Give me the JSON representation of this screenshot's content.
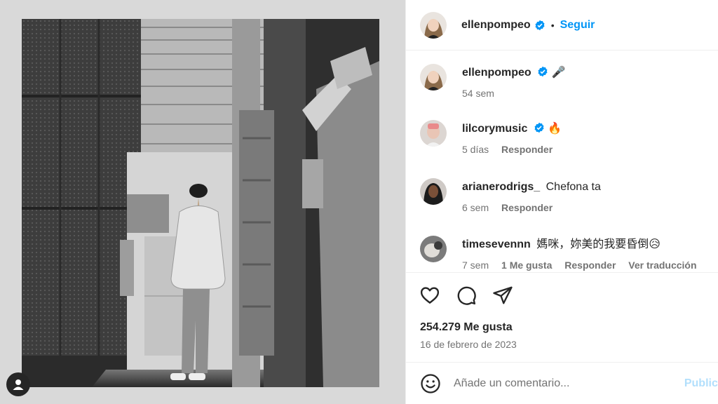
{
  "post_header": {
    "username": "ellenpompeo",
    "separator": "•",
    "follow_label": "Seguir"
  },
  "comments": [
    {
      "username": "ellenpompeo",
      "verified": true,
      "text": "🎤",
      "time": "54 sem",
      "reply": "",
      "likes": "",
      "translate": ""
    },
    {
      "username": "lilcorymusic",
      "verified": true,
      "text": "🔥",
      "time": "5 días",
      "reply": "Responder",
      "likes": "",
      "translate": ""
    },
    {
      "username": "arianerodrigs_",
      "verified": false,
      "text": "Chefona ta",
      "time": "6 sem",
      "reply": "Responder",
      "likes": "",
      "translate": ""
    },
    {
      "username": "timesevennn",
      "verified": false,
      "text": "媽咪，妳美的我要昏倒😥",
      "time": "7 sem",
      "reply": "Responder",
      "likes": "1 Me gusta",
      "translate": "Ver traducción"
    }
  ],
  "actions": {
    "icons": [
      "heart-icon",
      "comment-icon",
      "share-icon"
    ],
    "likes_text": "254.279 Me gusta",
    "date_text": "16 de febrero de 2023"
  },
  "comment_box": {
    "placeholder": "Añade un comentario...",
    "publish_label": "Publicar"
  },
  "colors": {
    "accent": "#0095f6",
    "verified": "#0095f6",
    "muted": "#737373"
  }
}
